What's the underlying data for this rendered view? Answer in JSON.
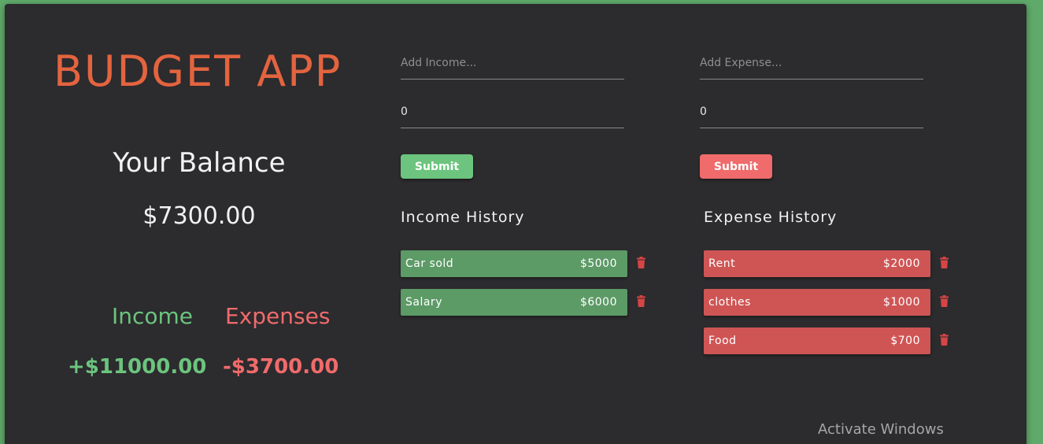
{
  "app": {
    "title": "BUDGET APP"
  },
  "balance": {
    "label": "Your Balance",
    "value": "$7300.00"
  },
  "summary": {
    "income_label": "Income",
    "expense_label": "Expenses",
    "income_total": "+$11000.00",
    "expense_total": "-$3700.00"
  },
  "income_form": {
    "name_placeholder": "Add Income...",
    "amount_value": "0",
    "submit_label": "Submit"
  },
  "expense_form": {
    "name_placeholder": "Add Expense...",
    "amount_value": "0",
    "submit_label": "Submit"
  },
  "income_history": {
    "title": "Income History",
    "items": [
      {
        "name": "Car sold",
        "amount": "$5000"
      },
      {
        "name": "Salary",
        "amount": "$6000"
      }
    ]
  },
  "expense_history": {
    "title": "Expense History",
    "items": [
      {
        "name": "Rent",
        "amount": "$2000"
      },
      {
        "name": "clothes",
        "amount": "$1000"
      },
      {
        "name": "Food",
        "amount": "$700"
      }
    ]
  },
  "watermark": "Activate Windows",
  "colors": {
    "page_bg": "#5fa96a",
    "card_bg": "#2c2b2e",
    "title": "#e3643f",
    "income": "#6cc47e",
    "expense": "#f06b6b",
    "income_item": "#5c9a66",
    "expense_item": "#cf5555",
    "trash": "#d64545"
  }
}
